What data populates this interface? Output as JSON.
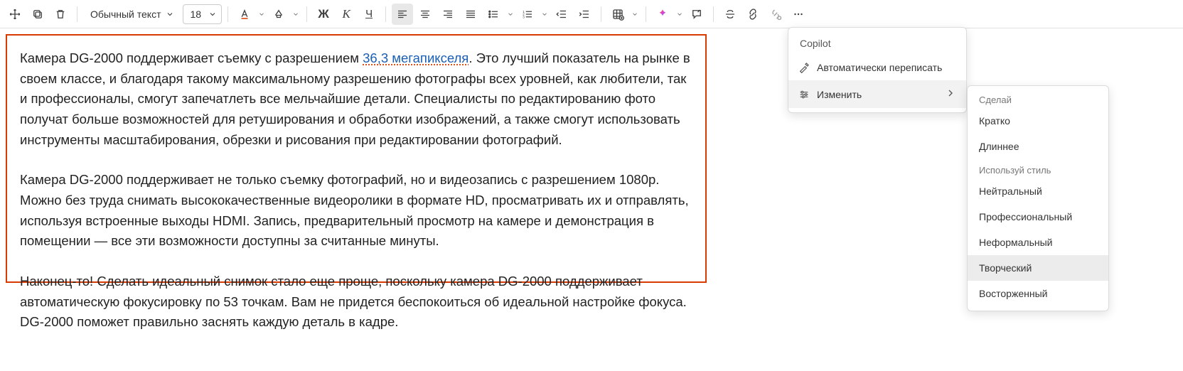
{
  "toolbar": {
    "style_label": "Обычный текст",
    "font_size": "18",
    "bold": "Ж",
    "italic": "К",
    "underline": "Ч"
  },
  "doc": {
    "p1a": "Камера DG-2000 поддерживает съемку с разрешением ",
    "p1_link": "36,3 мегапикселя",
    "p1b": ". Это лучший показатель на рынке в своем классе, и благодаря такому максимальному разрешению фотографы всех уровней, как любители, так и профессионалы, смогут запечатлеть все мельчайшие детали. Специалисты по редактированию фото получат больше возможностей для ретуширования и обработки изображений, а также смогут использовать инструменты масштабирования, обрезки и рисования при редактировании фотографий.",
    "p2": "Камера DG-2000 поддерживает не только съемку фотографий, но и видеозапись с разрешением 1080p. Можно без труда снимать высококачественные видеоролики в формате HD, просматривать их и отправлять, используя встроенные выходы HDMI. Запись, предварительный просмотр на камере и демонстрация в помещении — все эти возможности доступны за считанные минуты.",
    "p3": "Наконец-то! Сделать идеальный снимок стало еще проще, поскольку камера DG-2000 поддерживает автоматическую фокусировку по 53 точкам. Вам не придется беспокоиться об идеальной настройке фокуса. DG-2000 поможет правильно заснять каждую деталь в кадре."
  },
  "copilot_menu": {
    "header": "Copilot",
    "auto_rewrite": "Автоматически переписать",
    "adjust": "Изменить"
  },
  "sub_menu": {
    "sect1": "Сделай",
    "short": "Кратко",
    "long": "Длиннее",
    "sect2": "Используй стиль",
    "neutral": "Нейтральный",
    "professional": "Профессиональный",
    "informal": "Неформальный",
    "creative": "Творческий",
    "enthusiastic": "Восторженный"
  }
}
